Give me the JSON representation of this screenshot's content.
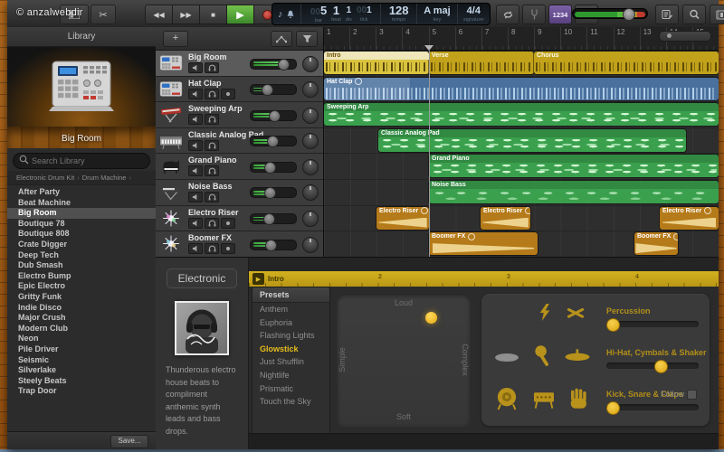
{
  "watermark": "© anzalwebdir",
  "toolbar": {
    "transport": {
      "rewind": "◀◀",
      "forward": "▶▶",
      "stop": "■",
      "play": "▶"
    },
    "lcd": {
      "note_icon": "♪",
      "fields": [
        {
          "pad": "00",
          "value": "5",
          "label": "bar"
        },
        {
          "pad": "",
          "value": "1",
          "label": "beat"
        },
        {
          "pad": "",
          "value": "1",
          "label": "div"
        },
        {
          "pad": "00",
          "value": "1",
          "label": "tick"
        }
      ],
      "tempo": {
        "value": "128",
        "label": "tempo"
      },
      "key": {
        "value": "A maj",
        "label": "key"
      },
      "signature": {
        "value": "4/4",
        "label": "signature"
      }
    },
    "count_in_label": "1234"
  },
  "library": {
    "title": "Library",
    "instrument_caption": "Big Room",
    "search_placeholder": "Search Library",
    "breadcrumb": {
      "level1": "Electronic Drum Kit",
      "sep": "›",
      "level2": "Drum Machine",
      "sep2": "›"
    },
    "items": [
      "After Party",
      "Beat Machine",
      "Big Room",
      "Boutique 78",
      "Boutique 808",
      "Crate Digger",
      "Deep Tech",
      "Dub Smash",
      "Electro Bump",
      "Epic Electro",
      "Gritty Funk",
      "Indie Disco",
      "Major Crush",
      "Modern Club",
      "Neon",
      "Pile Driver",
      "Seismic",
      "Silverlake",
      "Steely Beats",
      "Trap Door"
    ],
    "selected_item": "Big Room",
    "save_button": "Save..."
  },
  "track_header": {
    "add_label": "+"
  },
  "tracks": [
    {
      "name": "Big Room"
    },
    {
      "name": "Hat Clap"
    },
    {
      "name": "Sweeping Arp"
    },
    {
      "name": "Classic Analog Pad"
    },
    {
      "name": "Grand Piano"
    },
    {
      "name": "Noise Bass"
    },
    {
      "name": "Electro Riser"
    },
    {
      "name": "Boomer FX"
    }
  ],
  "timeline": {
    "bar_numbers": [
      "1",
      "2",
      "3",
      "4",
      "5",
      "6",
      "7",
      "8",
      "9",
      "10",
      "11",
      "12",
      "13",
      "14",
      "15"
    ],
    "rows": [
      {
        "regions": [
          {
            "label": "Intro"
          },
          {
            "label": "Verse"
          },
          {
            "label": "Chorus"
          }
        ]
      },
      {
        "regions": [
          {
            "label": "Hat Clap"
          }
        ]
      },
      {
        "regions": [
          {
            "label": "Sweeping Arp"
          }
        ]
      },
      {
        "regions": [
          {
            "label": "Classic Analog Pad"
          }
        ]
      },
      {
        "regions": [
          {
            "label": "Grand Piano"
          }
        ]
      },
      {
        "regions": [
          {
            "label": "Noise Bass"
          }
        ]
      },
      {
        "regions": [
          {
            "label": "Electro Riser"
          },
          {
            "label": "Electro Riser"
          },
          {
            "label": "Electro Riser"
          }
        ]
      },
      {
        "regions": [
          {
            "label": "Boomer FX"
          },
          {
            "label": "Boomer FX"
          }
        ]
      }
    ]
  },
  "smart_controls": {
    "category": "Electronic",
    "description": "Thunderous electro house beats to compliment anthemic synth leads and bass drops.",
    "editor": {
      "region_title": "Intro",
      "play_icon": "▶",
      "beat_numbers": [
        "2",
        "3",
        "4"
      ]
    },
    "presets": {
      "header": "Presets",
      "items": [
        "Anthem",
        "Euphoria",
        "Flashing Lights",
        "Glowstick",
        "Just Shufflin",
        "Nightlife",
        "Prismatic",
        "Touch the Sky"
      ],
      "selected": "Glowstick"
    },
    "xy_pad": {
      "top": "Loud",
      "bottom": "Soft",
      "left": "Simple",
      "right": "Complex"
    },
    "groups": [
      {
        "label": "Percussion"
      },
      {
        "label": "Hi-Hat, Cymbals & Shaker"
      },
      {
        "label": "Kick, Snare & Claps",
        "follow_label": "Follow"
      }
    ]
  },
  "colors": {
    "accent_yellow": "#d9b01c",
    "region_yellow": "#c2a21b",
    "region_blue": "#4a709d",
    "region_green": "#3aa04d",
    "region_orange": "#b57a19",
    "play_green": "#4e9e38",
    "record_red": "#bf3a2c",
    "purple": "#6e5593",
    "lcd_text": "#c7d8ea"
  }
}
